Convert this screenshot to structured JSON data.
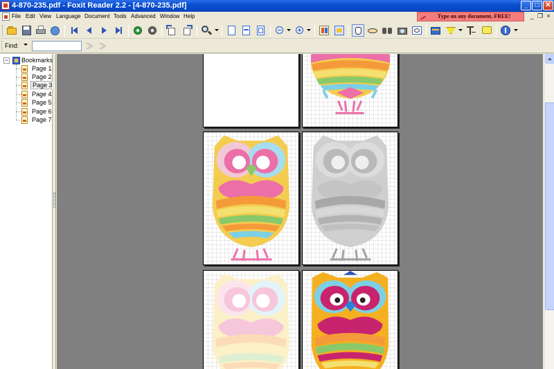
{
  "window": {
    "title": "4-870-235.pdf - Foxit Reader 2.2 - [4-870-235.pdf]",
    "minimize_glyph": "_",
    "maximize_glyph": "□",
    "close_glyph": "✕"
  },
  "menu": {
    "items": [
      "File",
      "Edit",
      "View",
      "Language",
      "Document",
      "Tools",
      "Advanced",
      "Window",
      "Help"
    ],
    "promo_text": "Type on any document, FREE!",
    "mdi_minimize": "_",
    "mdi_restore": "❐",
    "mdi_close": "×"
  },
  "toolbar": {
    "icons": [
      "open-icon",
      "save-icon",
      "print-icon",
      "email-icon",
      "first-page-icon",
      "previous-page-icon",
      "next-page-icon",
      "last-page-icon",
      "go-back-icon",
      "go-forward-icon",
      "rotate-left-icon",
      "rotate-right-icon",
      "zoom-icon",
      "fit-page-icon",
      "fit-width-icon",
      "fit-visible-icon",
      "zoom-out-icon",
      "zoom-in-icon",
      "single-page-icon",
      "continuous-icon",
      "hand-tool-icon",
      "text-select-icon",
      "find-icon",
      "snapshot-icon",
      "typewriter-icon",
      "highlight-icon",
      "text-tool-icon",
      "note-icon",
      "info-icon"
    ]
  },
  "find": {
    "label": "Find:",
    "value": "",
    "placeholder": ""
  },
  "bookmarks": {
    "root_label": "Bookmarks",
    "expander_glyph": "−",
    "items": [
      "Page 1",
      "Page 2",
      "Page 3",
      "Page 4",
      "Page 5",
      "Page 6",
      "Page 7"
    ],
    "selected": "Page 3"
  },
  "colors": {
    "title_bar": "#0a4fd0",
    "workspace": "#808080",
    "promo_bg": "#f47c7c",
    "owl_yellow": "#f4cc50",
    "owl_pink": "#ec6fa8",
    "owl_blue": "#7cd0e6",
    "owl_green": "#8ac96a",
    "owl_orange": "#f59a3a",
    "owl_magenta": "#c8246e"
  }
}
